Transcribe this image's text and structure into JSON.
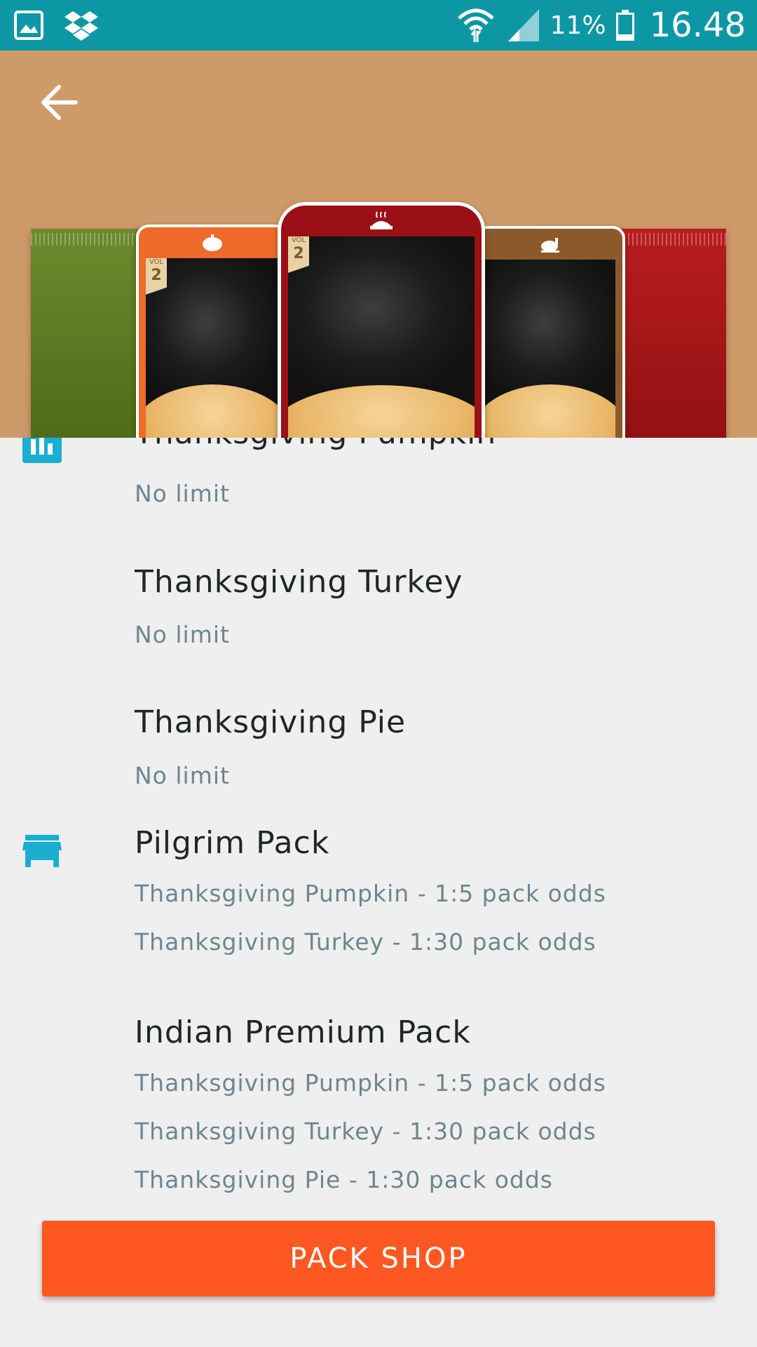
{
  "status_bar": {
    "battery_percent": "11%",
    "time": "16.48",
    "icons": [
      "gallery-icon",
      "dropbox-icon",
      "wifi-icon",
      "signal-icon",
      "battery-icon"
    ],
    "background": "#0d97a4"
  },
  "header": {
    "background": "#cf9a69",
    "cards": [
      {
        "vol_label": "VOL",
        "vol_number": "2"
      },
      {
        "vol_label": "VOL",
        "vol_number": "2"
      }
    ]
  },
  "list": {
    "partial_item": {
      "title": "Thanksgiving Pumpkin",
      "limit": "No limit"
    },
    "items": [
      {
        "title": "Thanksgiving Turkey",
        "limit": "No limit"
      },
      {
        "title": "Thanksgiving Pie",
        "limit": "No limit"
      }
    ],
    "packs": [
      {
        "title": "Pilgrim Pack",
        "odds": [
          "Thanksgiving Pumpkin - 1:5 pack odds",
          "Thanksgiving Turkey - 1:30 pack odds"
        ]
      },
      {
        "title": "Indian Premium Pack",
        "odds": [
          "Thanksgiving Pumpkin - 1:5 pack odds",
          "Thanksgiving Turkey - 1:30 pack odds",
          "Thanksgiving Pie - 1:30 pack odds"
        ]
      }
    ]
  },
  "actions": {
    "pack_shop_label": "PACK SHOP"
  },
  "colors": {
    "accent": "#fe5722",
    "icon": "#1aaed0",
    "title_text": "#1f2528",
    "sub_text": "#6e8590"
  }
}
